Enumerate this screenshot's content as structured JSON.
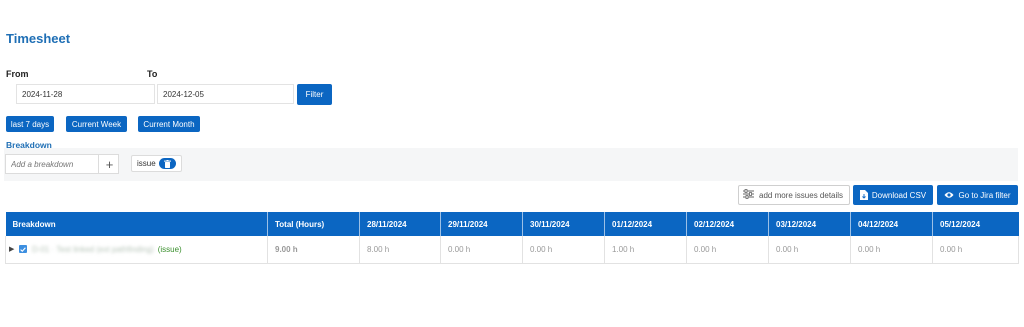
{
  "page": {
    "title": "Timesheet"
  },
  "filters": {
    "from_label": "From",
    "to_label": "To",
    "from_value": "2024-11-28",
    "to_value": "2024-12-05",
    "filter_button": "Filter",
    "quick_ranges": [
      "last 7 days",
      "Current Week",
      "Current Month"
    ]
  },
  "breakdown": {
    "label": "Breakdown",
    "input_placeholder": "Add a breakdown",
    "add_symbol": "+",
    "chip_label": "issue"
  },
  "actions": {
    "more_details": "add more issues details",
    "download_csv": "Download CSV",
    "go_to_jira": "Go to Jira filter"
  },
  "table": {
    "columns": [
      "Breakdown",
      "Total (Hours)",
      "28/11/2024",
      "29/11/2024",
      "30/11/2024",
      "01/12/2024",
      "02/12/2024",
      "03/12/2024",
      "04/12/2024",
      "05/12/2024"
    ],
    "rows": [
      {
        "name": "D-01 · Test linked (ext pathfinding)",
        "type": "(issue)",
        "total": "9.00 h",
        "days": [
          "8.00 h",
          "0.00 h",
          "0.00 h",
          "1.00 h",
          "0.00 h",
          "0.00 h",
          "0.00 h",
          "0.00 h"
        ]
      }
    ]
  },
  "colors": {
    "accent": "#0b66c2",
    "title": "#1f6fb5",
    "issue": "#3a8f2d",
    "total": "#1a1a8c"
  }
}
